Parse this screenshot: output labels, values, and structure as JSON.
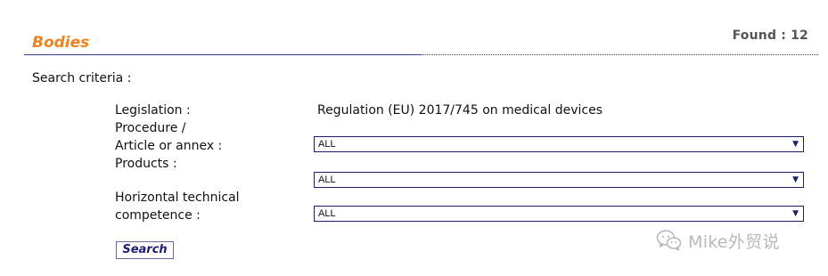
{
  "header": {
    "title": "Bodies",
    "found_text": "Found : 12"
  },
  "criteria_label": "Search criteria :",
  "form": {
    "legislation": {
      "label": "Legislation :",
      "value": "Regulation (EU) 2017/745 on medical devices"
    },
    "procedure": {
      "label_line1": "Procedure /",
      "label_line2": "Article or annex :",
      "value": "ALL"
    },
    "products": {
      "label": "Products :",
      "value": "ALL"
    },
    "horizontal": {
      "label_line1": "Horizontal technical",
      "label_line2": "competence :",
      "value": "ALL"
    },
    "search_label": "Search"
  },
  "watermark": {
    "text": "Mike外贸说",
    "icon": "wechat-icon"
  },
  "colors": {
    "title": "#f0821e",
    "rule": "#3c3c8c",
    "select_border": "#1c1c6c",
    "button_text": "#1c1c7c",
    "watermark": "#b9b9b9"
  }
}
